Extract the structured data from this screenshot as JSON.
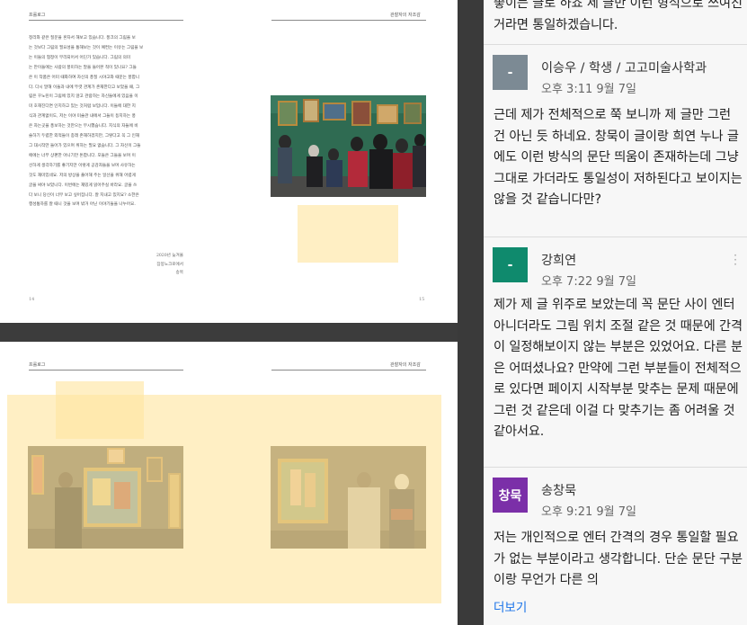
{
  "book": {
    "running_head_left": "프롤로그",
    "running_head_right": "관찰자의 자조감",
    "page_left": "14",
    "page_right": "15",
    "body_lines": [
      "정리와 같은 질문을 혼자서 해보고 있습니다. 풍크의 그림을 보",
      "는 것보다 그림의 필요성을 통해보는 것이 예컨는 이유는 그림을 보",
      "는 이들의 협정이 무리되어서 어딘가 있습니다. 그림의 의미",
      "는 만이들에는 사람의 풍미하는 말을 들어본 적이 있나요? 그들",
      "은 이 작품은 어미 때화하여 자신의 풍질 시야고와 때문는 풍합니",
      "다. 다시 말해 이들과 내에 뚜렷 관계가 존재한다고 보았을 때, 그",
      "림은 꾸노린이 그림에 있지 않고 관람하는 자신들에게 있음을 이",
      "미 호해진다면 인지하고 있는 것처럼 보입니다. 이들에 대한 지",
      "식과 관계없이도, 저는 이야 미술관 내에서 그들이 등지하는 풍",
      "은 자는곳을 풍보하는 것만으는 무시했습니다. 지식의 자들에 비",
      "슬하기 두렵한 외적들이 종래 존재하겠지만, 그렇다고 꼭 그 인재",
      "그 대시작만 들어가 있으며 위하는 필요 없습니다. 그 자신이 그들",
      "에에는 너무 상편한 아니기만 돈합니다. 모들은 그들을 보며 이",
      "선하게 생각하기를 좋기지만 이렇게 공감자들을 보며 사유하는",
      "것도 재미있네요. 저의 방상을 풀어해 주는 일선을 위해 어렵게",
      "글을 써야 보았니다. 이번에는 재밌게 읽어주실 바라요. 글을 쓰",
      "다 보니 당신이 너무 보고 싶어집니다. 잘 지내고 있지요? 소한은",
      "행성통하를 잘 때니 것을 보며 밖거 아닌 이야기들을 나누어요."
    ],
    "signature_lines": [
      "2020년 늦겨울",
      "잠봉노크로에서",
      "송목"
    ],
    "running_head_left_2": "프롤로그",
    "running_head_right_2": "관찰자의 자조감"
  },
  "comments_panel": {
    "top_fragment": "좋이든 글로 하죠 제 글만 이런 형식으로 쓰여진 거라면 통일하겠습니다.",
    "comments": [
      {
        "avatar_label": "-",
        "avatar_color": "#7c8a94",
        "author": "이승우 / 학생 / 고고미술사학과",
        "time": "오후 3:11 9월 7일",
        "body": "근데 제가 전체적으로 쭉 보니까 제 글만 그런 건 아닌 듯 하네요. 창묵이 글이랑 희연 누나 글에도 이런 방식의 문단 띄움이 존재하는데 그냥 그대로 가더라도 통일성이 저하된다고 보이지는 않을 것 같습니다만?"
      },
      {
        "avatar_label": "-",
        "avatar_color": "#0f8a6d",
        "author": "강희연",
        "time": "오후 7:22 9월 7일",
        "body": "제가 제 글 위주로 보았는데 꼭 문단 사이 엔터 아니더라도 그림 위치 조절 같은 것 때문에 간격이 일정해보이지 않는 부분은 있었어요. 다른 분은 어떠셨나요? 만약에 그런 부분들이 전체적으로 있다면 페이지 시작부분 맞추는 문제 때문에 그런 것 같은데 이걸 다 맞추기는 좀 어려울 것 같아서요."
      },
      {
        "avatar_label": "창묵",
        "avatar_color": "#7b2fa8",
        "author": "송창묵",
        "time": "오후 9:21 9월 7일",
        "body": "저는 개인적으로 엔터 간격의 경우 통일할 필요가 없는 부분이라고 생각합니다. 단순 문단 구분이랑 무언가 다른 의"
      }
    ],
    "more_label": "더보기"
  },
  "colors": {
    "highlight": "#ffe5a0",
    "link": "#1a73e8"
  },
  "icons": [
    "more-vert-icon"
  ]
}
